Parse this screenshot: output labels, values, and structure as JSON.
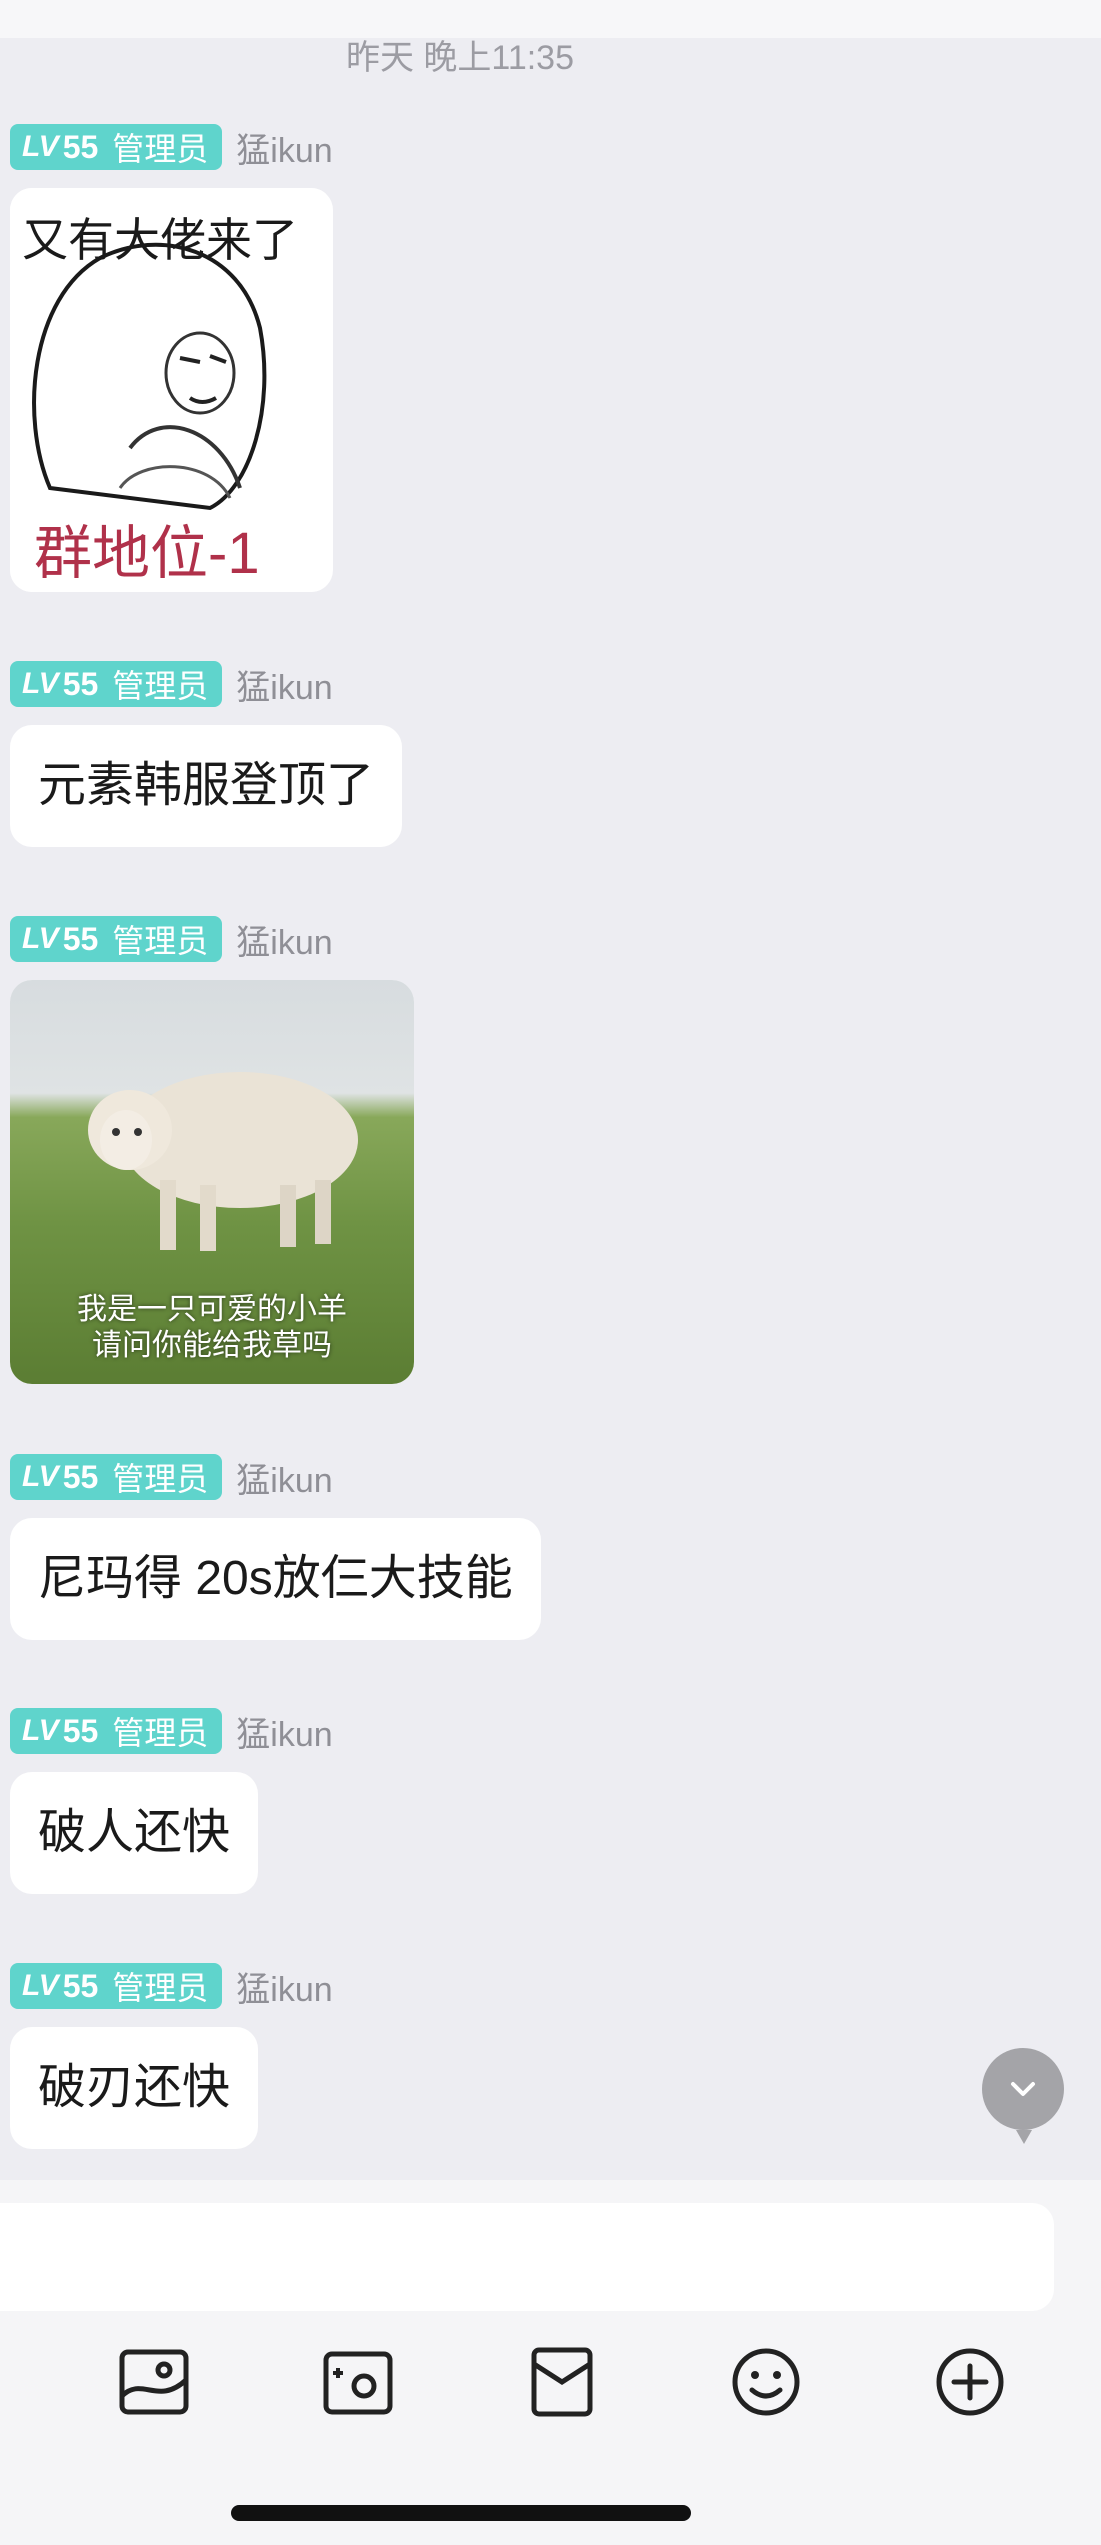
{
  "chat": {
    "timestamp": "昨天 晚上11:35",
    "messages": [
      {
        "badge": {
          "lv": "LV",
          "level": "55",
          "role": "管理员"
        },
        "sender": "猛ikun",
        "type": "image",
        "image": "meme-face",
        "caption_top": "又有大佬来了",
        "caption_bottom": "群地位-1"
      },
      {
        "badge": {
          "lv": "LV",
          "level": "55",
          "role": "管理员"
        },
        "sender": "猛ikun",
        "type": "text",
        "text": "元素韩服登顶了"
      },
      {
        "badge": {
          "lv": "LV",
          "level": "55",
          "role": "管理员"
        },
        "sender": "猛ikun",
        "type": "image",
        "image": "sheep-photo",
        "caption_line1": "我是一只可爱的小羊",
        "caption_line2": "请问你能给我草吗"
      },
      {
        "badge": {
          "lv": "LV",
          "level": "55",
          "role": "管理员"
        },
        "sender": "猛ikun",
        "type": "text",
        "text": "尼玛得 20s放仨大技能"
      },
      {
        "badge": {
          "lv": "LV",
          "level": "55",
          "role": "管理员"
        },
        "sender": "猛ikun",
        "type": "text",
        "text": "破人还快"
      },
      {
        "badge": {
          "lv": "LV",
          "level": "55",
          "role": "管理员"
        },
        "sender": "猛ikun",
        "type": "text",
        "text": "破刃还快"
      }
    ]
  },
  "colors": {
    "badge": "#5fd4cc",
    "background": "#ededf2",
    "bubble": "#ffffff"
  },
  "toolbar": {
    "icons": [
      "image-icon",
      "camera-icon",
      "red-packet-icon",
      "emoji-icon",
      "plus-icon"
    ]
  },
  "scroll_button": {
    "icon": "chevron-down-icon"
  }
}
